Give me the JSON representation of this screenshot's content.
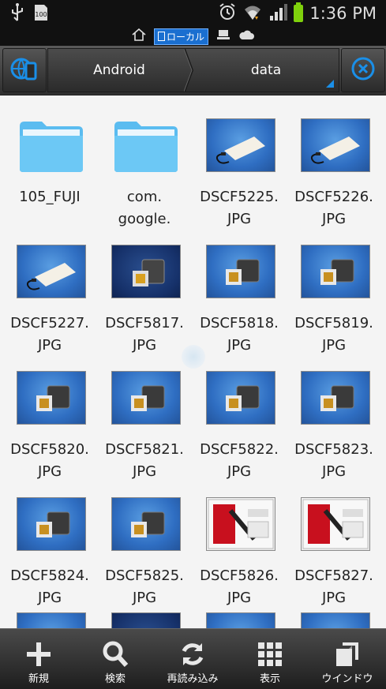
{
  "status_bar": {
    "time": "1:36 PM",
    "icons": [
      "usb-icon",
      "sd-card-icon",
      "alarm-icon",
      "wifi-icon",
      "signal-icon",
      "battery-icon"
    ]
  },
  "substatus": {
    "home_icon": "home-icon",
    "local_label": "ローカル",
    "lan_icon": "computer-icon",
    "cloud_icon": "cloud-icon"
  },
  "toolbar": {
    "left_icon": "local-device-icon",
    "breadcrumb": [
      "Android",
      "data"
    ],
    "right_icon": "close-circle-icon"
  },
  "files": [
    {
      "name_line1": "105_FUJI",
      "name_line2": "",
      "type": "folder"
    },
    {
      "name_line1": "com.",
      "name_line2": "google.",
      "type": "folder"
    },
    {
      "name_line1": "DSCF5225.",
      "name_line2": "JPG",
      "type": "image",
      "style": "card"
    },
    {
      "name_line1": "DSCF5226.",
      "name_line2": "JPG",
      "type": "image",
      "style": "card"
    },
    {
      "name_line1": "DSCF5227.",
      "name_line2": "JPG",
      "type": "image",
      "style": "card"
    },
    {
      "name_line1": "DSCF5817.",
      "name_line2": "JPG",
      "type": "image",
      "style": "dark"
    },
    {
      "name_line1": "DSCF5818.",
      "name_line2": "JPG",
      "type": "image",
      "style": "blue"
    },
    {
      "name_line1": "DSCF5819.",
      "name_line2": "JPG",
      "type": "image",
      "style": "blue"
    },
    {
      "name_line1": "DSCF5820.",
      "name_line2": "JPG",
      "type": "image",
      "style": "blue"
    },
    {
      "name_line1": "DSCF5821.",
      "name_line2": "JPG",
      "type": "image",
      "style": "blue"
    },
    {
      "name_line1": "DSCF5822.",
      "name_line2": "JPG",
      "type": "image",
      "style": "blue"
    },
    {
      "name_line1": "DSCF5823.",
      "name_line2": "JPG",
      "type": "image",
      "style": "blue"
    },
    {
      "name_line1": "DSCF5824.",
      "name_line2": "JPG",
      "type": "image",
      "style": "blue"
    },
    {
      "name_line1": "DSCF5825.",
      "name_line2": "JPG",
      "type": "image",
      "style": "blue"
    },
    {
      "name_line1": "DSCF5826.",
      "name_line2": "JPG",
      "type": "image",
      "style": "red"
    },
    {
      "name_line1": "DSCF5827.",
      "name_line2": "JPG",
      "type": "image",
      "style": "red"
    }
  ],
  "bottom_bar": [
    {
      "label": "新規",
      "icon": "plus-icon"
    },
    {
      "label": "検索",
      "icon": "search-icon"
    },
    {
      "label": "再読み込み",
      "icon": "refresh-icon"
    },
    {
      "label": "表示",
      "icon": "grid-view-icon"
    },
    {
      "label": "ウインドウ",
      "icon": "windows-icon"
    }
  ],
  "colors": {
    "accent": "#1a8fe8",
    "folder": "#5bbcf0",
    "background": "#f4f4f4"
  }
}
